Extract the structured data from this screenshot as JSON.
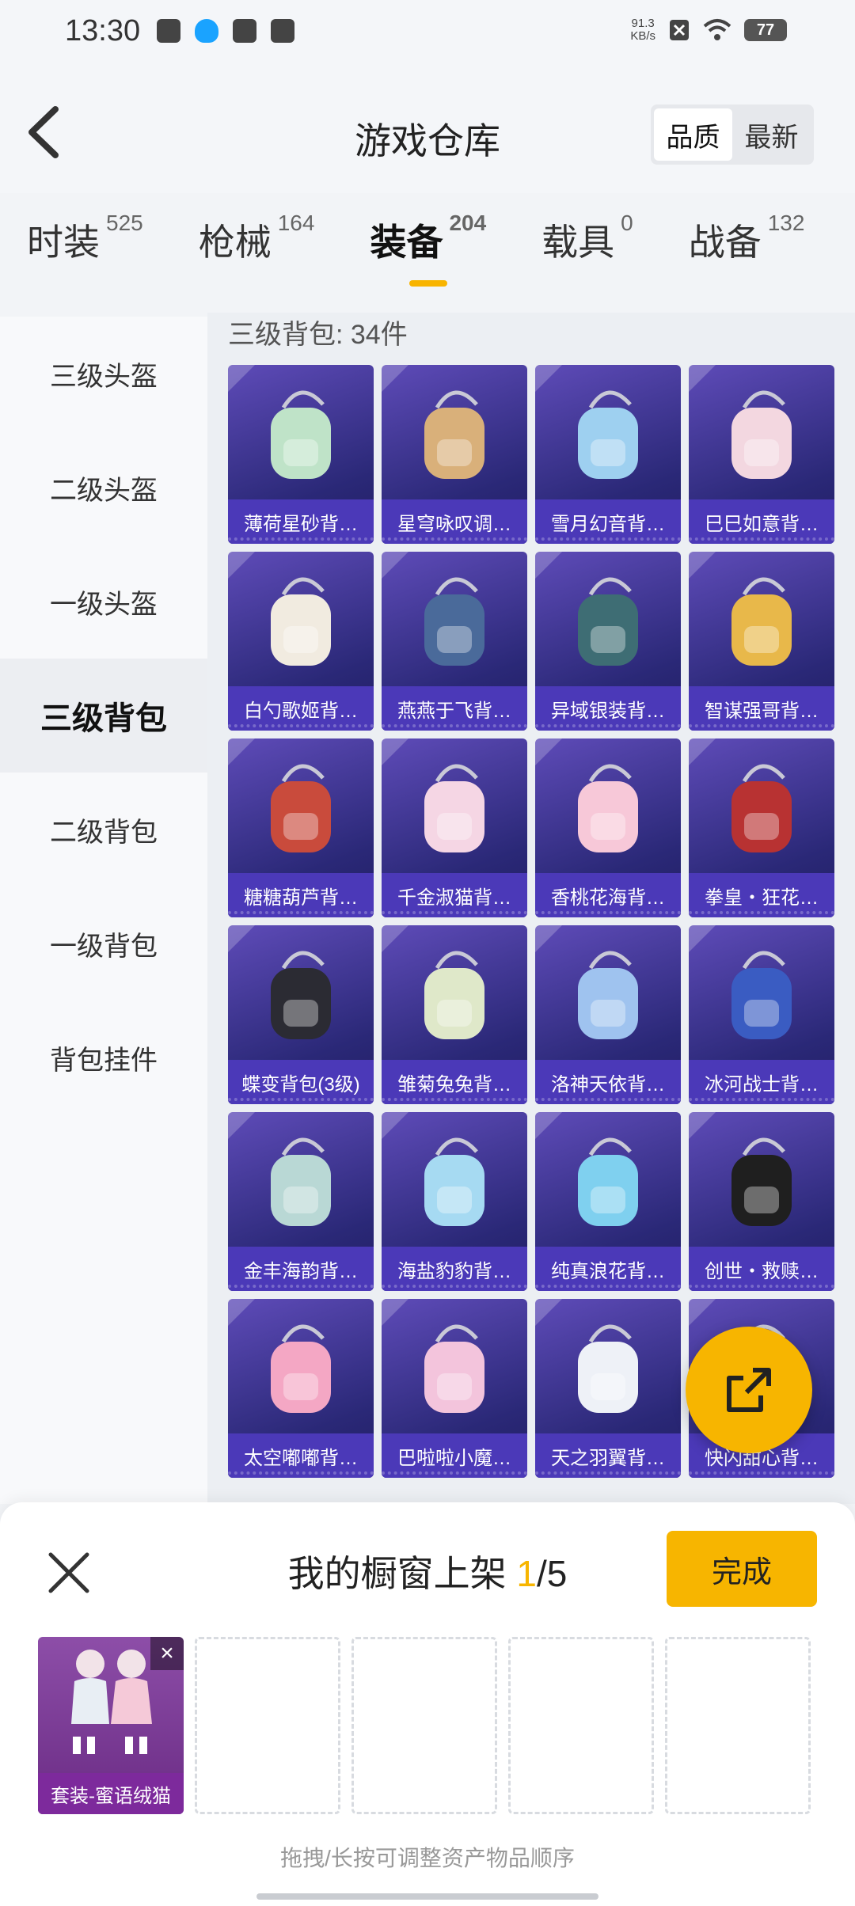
{
  "status": {
    "time": "13:30",
    "netspeed": "91.3\nKB/s",
    "battery": "77"
  },
  "header": {
    "title": "游戏仓库",
    "sort_options": [
      "品质",
      "最新"
    ],
    "sort_active": 0
  },
  "tabs": [
    {
      "label": "时装",
      "count": "525"
    },
    {
      "label": "枪械",
      "count": "164"
    },
    {
      "label": "装备",
      "count": "204",
      "active": true
    },
    {
      "label": "载具",
      "count": "0"
    },
    {
      "label": "战备",
      "count": "132"
    }
  ],
  "sidebar": {
    "items": [
      "三级头盔",
      "二级头盔",
      "一级头盔",
      "三级背包",
      "二级背包",
      "一级背包",
      "背包挂件"
    ],
    "active": 3
  },
  "section": {
    "title": "三级背包: 34件"
  },
  "items": [
    {
      "label": "薄荷星砂背…",
      "color": "#bfe3c8"
    },
    {
      "label": "星穹咏叹调…",
      "color": "#d9b07a"
    },
    {
      "label": "雪月幻音背…",
      "color": "#9ed0f0"
    },
    {
      "label": "巳巳如意背…",
      "color": "#f3d7e0"
    },
    {
      "label": "白勺歌姬背…",
      "color": "#f1ebe0"
    },
    {
      "label": "燕燕于飞背…",
      "color": "#4a6a9a"
    },
    {
      "label": "异域银装背…",
      "color": "#3e6d74"
    },
    {
      "label": "智谋强哥背…",
      "color": "#e8b84a"
    },
    {
      "label": "糖糖葫芦背…",
      "color": "#c94b3c"
    },
    {
      "label": "千金淑猫背…",
      "color": "#f5d6e4"
    },
    {
      "label": "香桃花海背…",
      "color": "#f7c8d8"
    },
    {
      "label": "拳皇・狂花…",
      "color": "#b83232"
    },
    {
      "label": "蝶变背包(3级)",
      "color": "#2b2b33"
    },
    {
      "label": "雏菊兔兔背…",
      "color": "#dfe8c9"
    },
    {
      "label": "洛神天依背…",
      "color": "#9fc3ef"
    },
    {
      "label": "冰河战士背…",
      "color": "#3a5cc2"
    },
    {
      "label": "金丰海韵背…",
      "color": "#b9d8d5"
    },
    {
      "label": "海盐豹豹背…",
      "color": "#a6daf2"
    },
    {
      "label": "纯真浪花背…",
      "color": "#7fd0ef"
    },
    {
      "label": "创世・救赎…",
      "color": "#1f1f1f"
    },
    {
      "label": "太空嘟嘟背…",
      "color": "#f4a7c4"
    },
    {
      "label": "巴啦啦小魔…",
      "color": "#f3c4dc"
    },
    {
      "label": "天之羽翼背…",
      "color": "#eef1f7"
    },
    {
      "label": "快闪甜心背…",
      "color": "#f0b9cf"
    }
  ],
  "panel": {
    "title_prefix": "我的橱窗上架 ",
    "count": "1",
    "total": "/5",
    "done_label": "完成",
    "slots": [
      {
        "label": "套装-蜜语绒猫",
        "filled": true
      },
      {
        "filled": false
      },
      {
        "filled": false
      },
      {
        "filled": false
      },
      {
        "filled": false
      }
    ],
    "hint": "拖拽/长按可调整资产物品顺序"
  },
  "colors": {
    "accent": "#f7b500",
    "card_bg": "#3a2f9a"
  }
}
